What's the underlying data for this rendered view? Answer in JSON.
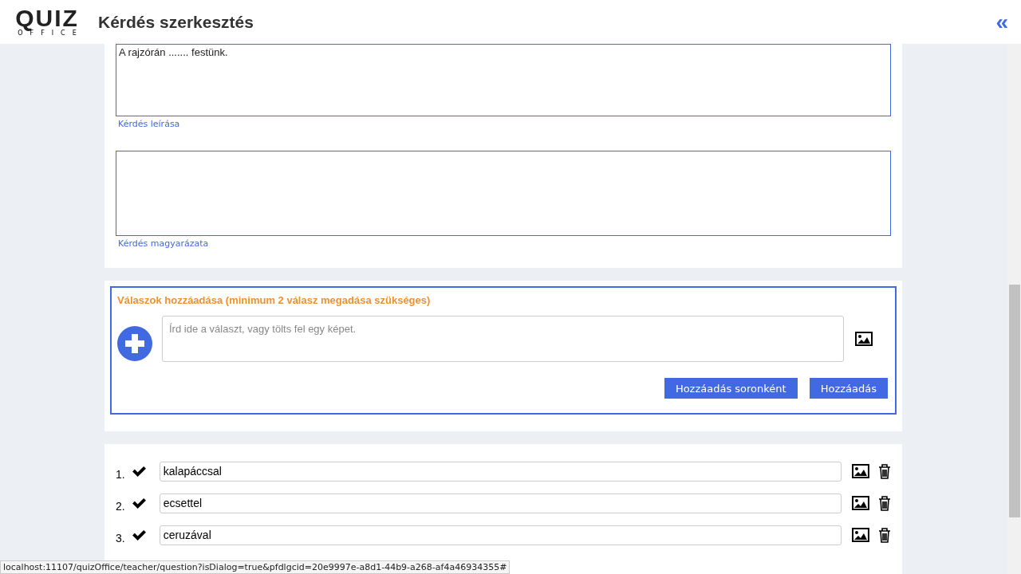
{
  "header": {
    "logo_word": "QUIZ",
    "logo_sub": "OFFICE",
    "title": "Kérdés szerkesztés",
    "collapse": "«"
  },
  "question": {
    "text": "A rajzórán ....... festünk.",
    "text_label": "Kérdés leírása",
    "explanation_label": "Kérdés magyarázata"
  },
  "add_answers": {
    "title": "Válaszok hozzáadása (minimum 2 válasz megadása szükséges)",
    "placeholder": "Írd ide a választ, vagy tölts fel egy képet.",
    "buttons": [
      "Hozzáadás soronként",
      "Hozzáadás"
    ]
  },
  "answers": [
    {
      "number": "1.",
      "correct": true,
      "text": "kalapáccsal"
    },
    {
      "number": "2.",
      "correct": true,
      "text": "ecsettel"
    },
    {
      "number": "3.",
      "correct": true,
      "text": "ceruzával"
    }
  ],
  "status_bar": "localhost:11107/quizOffice/teacher/question?isDialog=true&pfdlgcid=20e9997e-a8d1-44b9-a268-af4a46934355#"
}
